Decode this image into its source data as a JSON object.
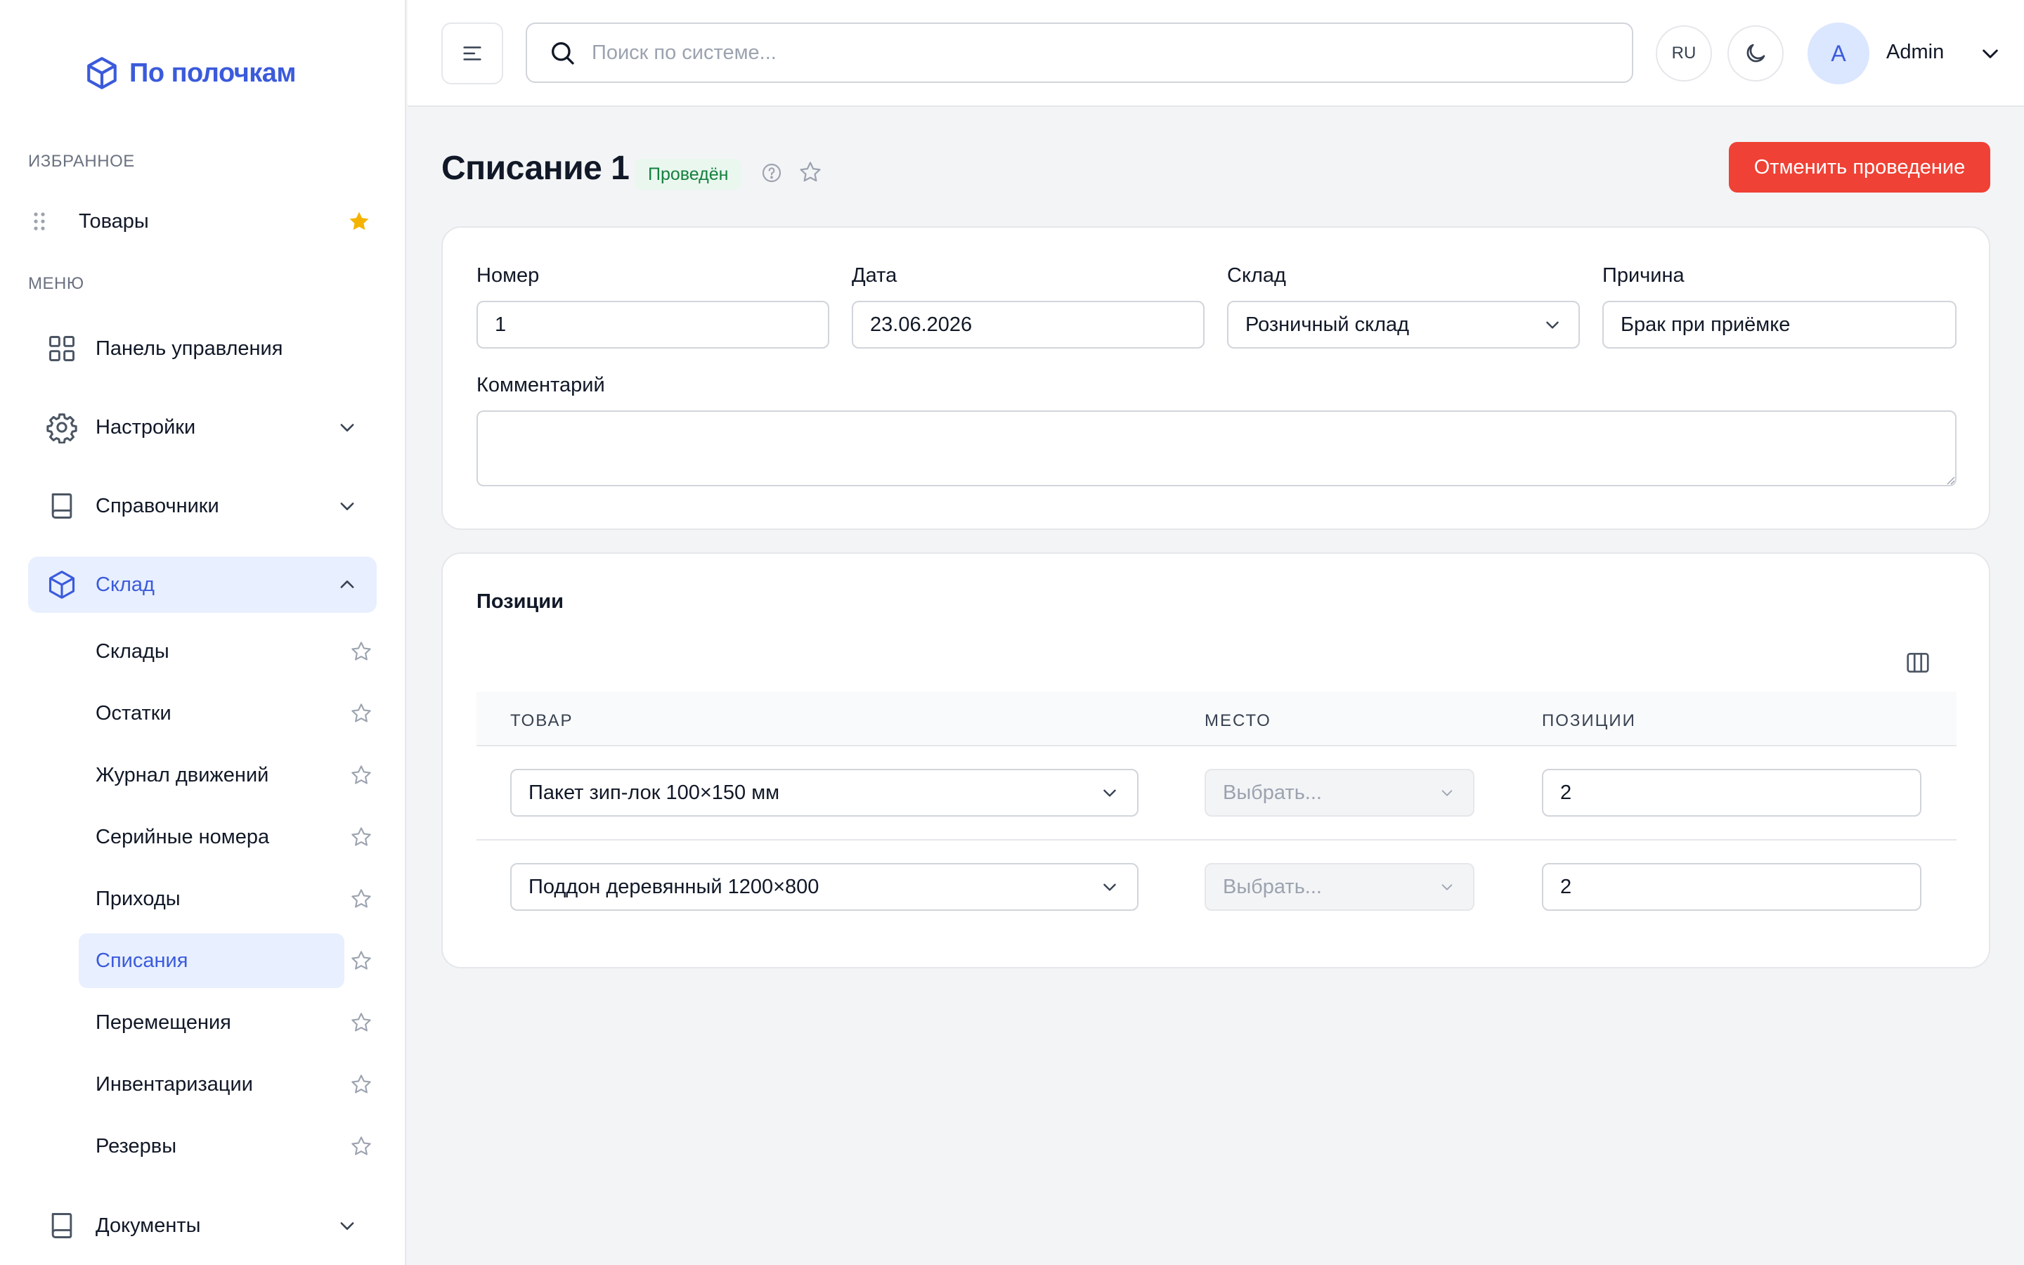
{
  "app": {
    "logo_text": "По полочкам"
  },
  "sidebar": {
    "favorites_label": "ИЗБРАННОЕ",
    "favorites": [
      {
        "label": "Товары",
        "starred": true
      }
    ],
    "menu_label": "МЕНЮ",
    "items": [
      {
        "label": "Панель управления",
        "icon": "dashboard-grid-icon"
      },
      {
        "label": "Настройки",
        "icon": "gear-icon"
      },
      {
        "label": "Справочники",
        "icon": "book-icon"
      },
      {
        "label": "Склад",
        "icon": "box-icon",
        "expanded": true
      },
      {
        "label": "Документы",
        "icon": "book-icon"
      }
    ],
    "warehouse_subitems": [
      {
        "label": "Склады"
      },
      {
        "label": "Остатки"
      },
      {
        "label": "Журнал движений"
      },
      {
        "label": "Серийные номера"
      },
      {
        "label": "Приходы"
      },
      {
        "label": "Списания",
        "active": true
      },
      {
        "label": "Перемещения"
      },
      {
        "label": "Инвентаризации"
      },
      {
        "label": "Резервы"
      }
    ]
  },
  "topbar": {
    "search_placeholder": "Поиск по системе...",
    "language": "RU",
    "avatar_letter": "A",
    "user_name": "Admin"
  },
  "page": {
    "title": "Списание 1",
    "status": "Проведён",
    "cancel_button": "Отменить проведение"
  },
  "form": {
    "number_label": "Номер",
    "number_value": "1",
    "date_label": "Дата",
    "date_value": "23.06.2026",
    "warehouse_label": "Склад",
    "warehouse_value": "Розничный склад",
    "reason_label": "Причина",
    "reason_value": "Брак при приёмке",
    "comment_label": "Комментарий",
    "comment_value": ""
  },
  "positions": {
    "title": "Позиции",
    "columns": [
      "ТОВАР",
      "МЕСТО",
      "ПОЗИЦИИ"
    ],
    "place_placeholder": "Выбрать...",
    "rows": [
      {
        "product": "Пакет зип-лок 100×150 мм",
        "place": "",
        "qty": "2"
      },
      {
        "product": "Поддон деревянный 1200×800",
        "place": "",
        "qty": "2"
      }
    ]
  },
  "colors": {
    "accent": "#3b5bdb",
    "active_bg": "#e8efff",
    "danger": "#ef4135",
    "success_text": "#15803d",
    "success_bg": "#e9f7ef",
    "star_filled": "#f5b300"
  }
}
